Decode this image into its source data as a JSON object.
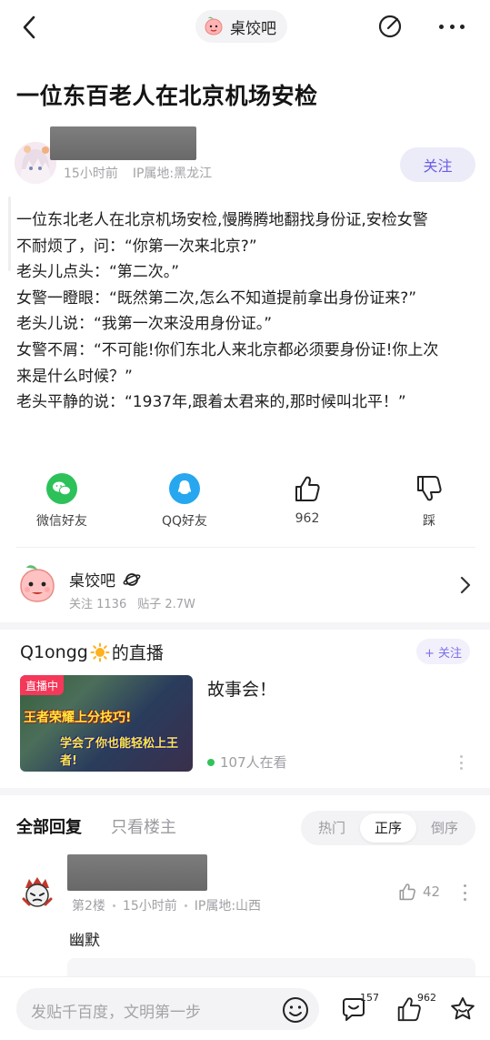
{
  "header": {
    "forum_name": "桌饺吧"
  },
  "post": {
    "title": "一位东百老人在北京机场安检",
    "author_meta": {
      "time": "15小时前",
      "ip": "IP属地:黑龙江"
    },
    "follow_label": "关注",
    "body_lines": [
      "一位东北老人在北京机场安检,慢腾腾地翻找身份证,安检女警",
      "不耐烦了，问：“你第一次来北京?”",
      "老头儿点头：“第二次。”",
      "女警一瞪眼：“既然第二次,怎么不知道提前拿出身份证来?”",
      "老头儿说：“我第一次来没用身份证。”",
      "女警不屑：“不可能!你们东北人来北京都必须要身份证!你上次",
      "来是什么时候？”",
      "老头平静的说：“1937年,跟着太君来的,那时候叫北平！”"
    ]
  },
  "actions": {
    "wechat": "微信好友",
    "qq": "QQ好友",
    "like_count": "962",
    "dislike": "踩"
  },
  "forum_card": {
    "name": "桌饺吧",
    "followers": "关注 1136",
    "posts": "贴子 2.7W"
  },
  "live": {
    "streamer": "Q1ongg",
    "suffix": "的直播",
    "follow_label": "+ 关注",
    "badge": "直播中",
    "game_text_1": "王者荣耀上分技巧!",
    "game_text_2": "学会了你也能轻松上王者!",
    "title": "故事会！",
    "viewers": "107人在看"
  },
  "replies": {
    "tab_all": "全部回复",
    "tab_op": "只看楼主",
    "sort": [
      "热门",
      "正序",
      "倒序"
    ]
  },
  "comment": {
    "floor": "第2楼",
    "time": "15小时前",
    "ip": "IP属地:山西",
    "likes": "42",
    "text": "幽默"
  },
  "bottom": {
    "placeholder": "发贴千百度，文明第一步",
    "comment_count": "157",
    "like_count": "962"
  },
  "colors": {
    "accent": "#6a5ee5",
    "live_red": "#f4385a",
    "wechat": "#2dc15a",
    "qq": "#27a7ef"
  }
}
